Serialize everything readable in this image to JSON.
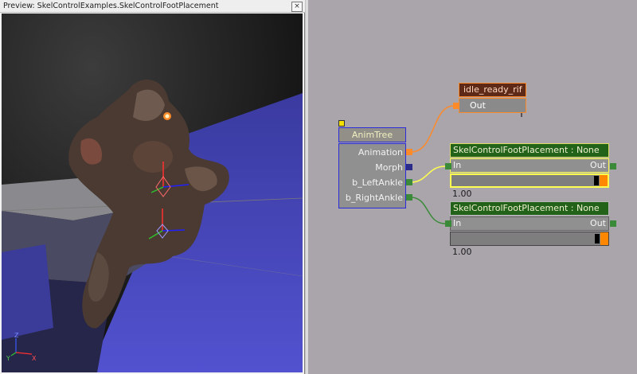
{
  "preview": {
    "title": "Preview: SkelControlExamples.SkelControlFootPlacement",
    "close_glyph": "×",
    "axes": {
      "z": "Z",
      "y": "Y",
      "x": "X"
    }
  },
  "graph": {
    "animtree": {
      "title": "AnimTree",
      "inputs": [
        "Animation",
        "Morph",
        "b_LeftAnkle",
        "b_RightAnkle"
      ]
    },
    "idle": {
      "title": "idle_ready_rif",
      "out": "Out"
    },
    "skel_controls": [
      {
        "title": "SkelControlFootPlacement : None",
        "in": "In",
        "out": "Out",
        "weight": "1.00"
      },
      {
        "title": "SkelControlFootPlacement : None",
        "in": "In",
        "out": "Out",
        "weight": "1.00"
      }
    ],
    "colors": {
      "animation_wire": "#ff8a2a",
      "left_ankle_wire": "#ffff50",
      "right_ankle_wire": "#3a8a3a",
      "morph_connector": "#2b2b8a"
    }
  }
}
